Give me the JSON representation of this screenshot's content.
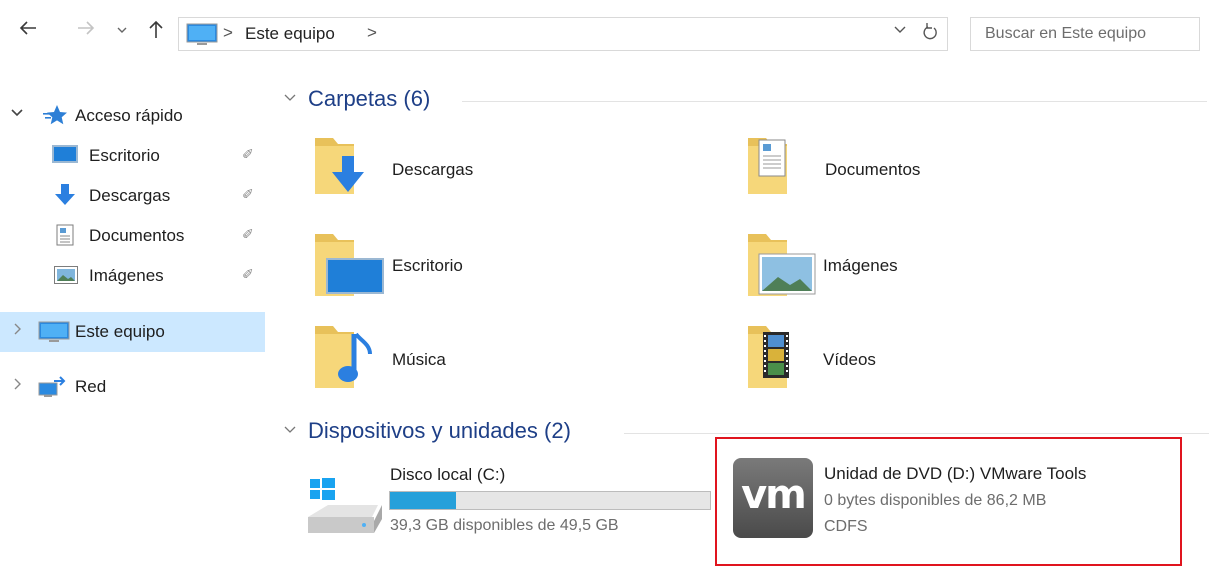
{
  "address_bar": {
    "back_icon": "arrow-left-icon",
    "forward_icon": "arrow-right-icon",
    "recent_icon": "chevron-down-icon",
    "up_icon": "arrow-up-icon",
    "location_icon": "computer-icon",
    "crumb": "Este equipo",
    "separator": ">",
    "search_placeholder": "Buscar en Este equipo"
  },
  "sidebar": {
    "quick_access": {
      "label": "Acceso rápido",
      "icon": "star-icon"
    },
    "pinned": [
      {
        "label": "Escritorio",
        "icon": "desktop-icon"
      },
      {
        "label": "Descargas",
        "icon": "download-arrow-icon"
      },
      {
        "label": "Documentos",
        "icon": "document-icon"
      },
      {
        "label": "Imágenes",
        "icon": "pictures-icon"
      }
    ],
    "this_pc": {
      "label": "Este equipo",
      "icon": "computer-icon"
    },
    "network": {
      "label": "Red",
      "icon": "network-icon"
    }
  },
  "folders_group": {
    "title": "Carpetas (6)",
    "items": [
      {
        "label": "Descargas",
        "icon": "downloads-folder-icon"
      },
      {
        "label": "Documentos",
        "icon": "documents-folder-icon"
      },
      {
        "label": "Escritorio",
        "icon": "desktop-folder-icon"
      },
      {
        "label": "Imágenes",
        "icon": "pictures-folder-icon"
      },
      {
        "label": "Música",
        "icon": "music-folder-icon"
      },
      {
        "label": "Vídeos",
        "icon": "videos-folder-icon"
      }
    ]
  },
  "devices_group": {
    "title": "Dispositivos y unidades (2)",
    "drives": [
      {
        "name": "Disco local (C:)",
        "free_text": "39,3 GB disponibles de 49,5 GB",
        "used_fraction": 0.206,
        "icon": "windows-drive-icon"
      },
      {
        "name": "Unidad de DVD (D:) VMware Tools",
        "free_text": "0 bytes disponibles de 86,2 MB",
        "filesystem": "CDFS",
        "icon": "vmware-logo-icon",
        "logo_text": "vm"
      }
    ]
  },
  "colors": {
    "accent": "#26a0da",
    "group_title": "#1e3f87",
    "selection": "#cce8ff",
    "highlight_border": "#e0141e"
  }
}
